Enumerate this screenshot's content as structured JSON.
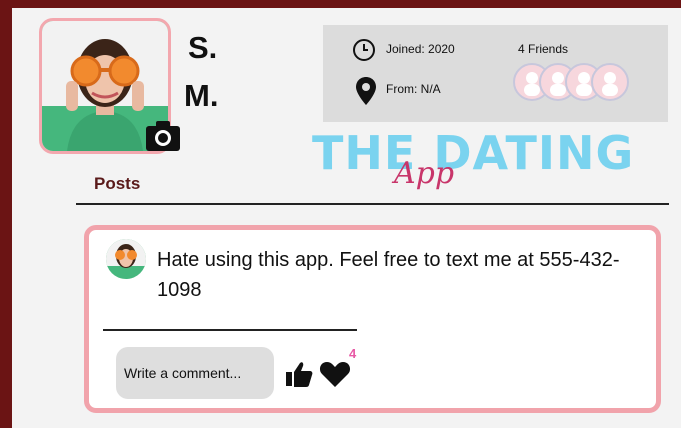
{
  "profile": {
    "name_line1": "S.",
    "name_line2": "M.",
    "joined": "Joined: 2020",
    "from": "From: N/A",
    "friends": "4 Friends",
    "friends_count": 4
  },
  "brand": {
    "title_main": "THE DATING",
    "title_script": "App"
  },
  "nav": {
    "posts_tab": "Posts"
  },
  "post": {
    "text": "Hate using this app. Feel free to text me at 555-432-1098",
    "comment_placeholder": "Write a comment...",
    "heart_count": "4"
  },
  "icons": {
    "camera": "camera-icon",
    "clock": "clock-icon",
    "location": "location-pin-icon",
    "like": "thumbs-up-icon",
    "heart": "heart-icon"
  },
  "colors": {
    "frame_border": "#6b1414",
    "card_border": "#f1a3ab",
    "title_blue": "#7ad3ef",
    "title_script": "#c8356a",
    "count_pink": "#e85aa6"
  }
}
